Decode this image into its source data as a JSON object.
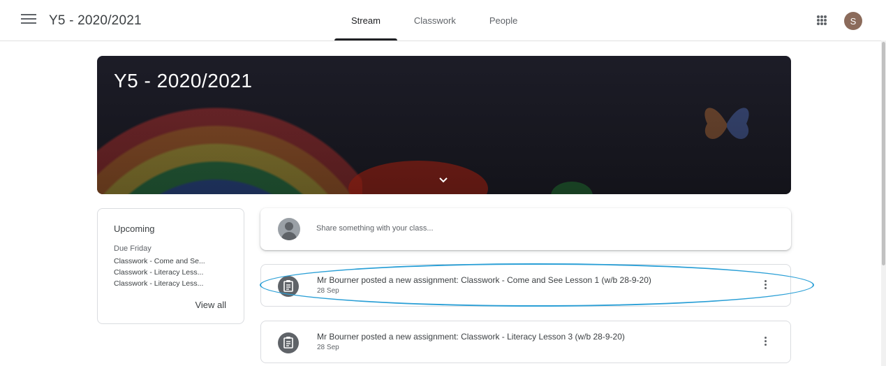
{
  "header": {
    "class_name": "Y5 - 2020/2021",
    "tabs": [
      {
        "label": "Stream",
        "active": true
      },
      {
        "label": "Classwork",
        "active": false
      },
      {
        "label": "People",
        "active": false
      }
    ],
    "avatar_initial": "S",
    "icons": {
      "menu": "menu-icon",
      "apps": "apps-grid-icon"
    }
  },
  "banner": {
    "title": "Y5 - 2020/2021",
    "icon": "chevron-down-icon"
  },
  "upcoming": {
    "heading": "Upcoming",
    "due_label": "Due Friday",
    "items": [
      "Classwork - Come and Se...",
      "Classwork - Literacy Less...",
      "Classwork - Literacy Less..."
    ],
    "view_all": "View all"
  },
  "share": {
    "placeholder": "Share something with your class..."
  },
  "posts": [
    {
      "title": "Mr Bourner posted a new assignment: Classwork - Come and See Lesson 1 (w/b 28-9-20)",
      "date": "28 Sep",
      "highlighted": true
    },
    {
      "title": "Mr Bourner posted a new assignment: Classwork - Literacy Lesson 3 (w/b 28-9-20)",
      "date": "28 Sep",
      "highlighted": false
    }
  ],
  "colors": {
    "highlight_outline": "#2a9fd6",
    "avatar": "#8b6b5b",
    "icon_grey": "#5f6368"
  }
}
